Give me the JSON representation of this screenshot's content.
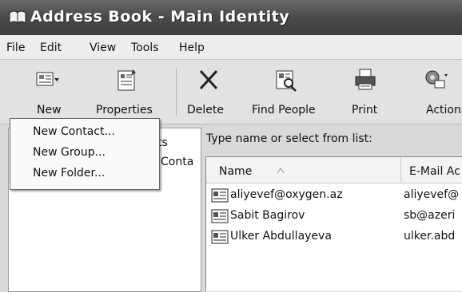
{
  "window": {
    "title": "Address Book - Main Identity"
  },
  "menubar": {
    "items": [
      "File",
      "Edit",
      "View",
      "Tools",
      "Help"
    ]
  },
  "toolbar": {
    "buttons": [
      {
        "label": "New",
        "icon": "new-card-icon"
      },
      {
        "label": "Properties",
        "icon": "properties-icon"
      },
      {
        "label": "Delete",
        "icon": "delete-x-icon"
      },
      {
        "label": "Find People",
        "icon": "find-people-icon"
      },
      {
        "label": "Print",
        "icon": "printer-icon"
      },
      {
        "label": "Action",
        "icon": "action-icon"
      }
    ]
  },
  "new_menu": {
    "items": [
      "New Contact...",
      "New Group...",
      "New Folder..."
    ]
  },
  "folders": {
    "partial_1": "ts",
    "partial_2": "Conta"
  },
  "contacts": {
    "prompt": "Type name or select from list:",
    "columns": [
      "Name",
      "E-Mail Ac"
    ],
    "rows": [
      {
        "name": "aliyevef@oxygen.az",
        "email": "aliyevef@"
      },
      {
        "name": "Sabit Bagirov",
        "email": "sb@azeri"
      },
      {
        "name": "Ulker Abdullayeva",
        "email": "ulker.abd"
      }
    ]
  }
}
